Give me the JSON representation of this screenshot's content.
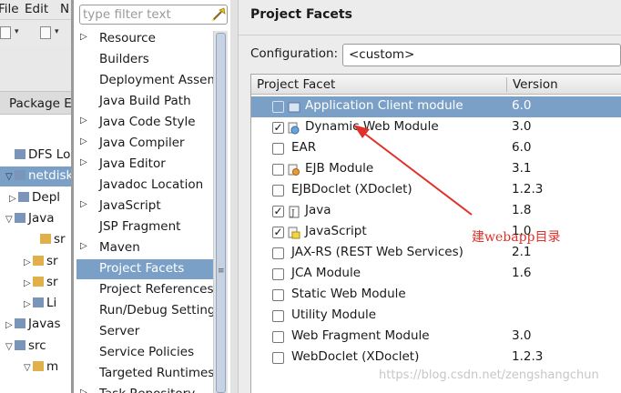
{
  "menubar": {
    "items": [
      "File",
      "Edit",
      "N"
    ]
  },
  "package_tab": {
    "label": "Package E"
  },
  "left_tree": [
    {
      "label": "DFS Loc",
      "twisty": ""
    },
    {
      "label": "netdisk",
      "twisty": "▽"
    },
    {
      "label": "Depl",
      "twisty": "▷"
    },
    {
      "label": "Java",
      "twisty": "▽"
    },
    {
      "label": "sr",
      "twisty": ""
    },
    {
      "label": "sr",
      "twisty": "▷"
    },
    {
      "label": "sr",
      "twisty": "▷"
    },
    {
      "label": "Li",
      "twisty": "▷"
    },
    {
      "label": "Javas",
      "twisty": "▷"
    },
    {
      "label": "src",
      "twisty": "▽"
    },
    {
      "label": "m",
      "twisty": "▽"
    }
  ],
  "filter": {
    "placeholder": "type filter text"
  },
  "nav": {
    "items": [
      {
        "label": "Resource",
        "expandable": true
      },
      {
        "label": "Builders",
        "expandable": false
      },
      {
        "label": "Deployment Assem",
        "expandable": false
      },
      {
        "label": "Java Build Path",
        "expandable": false
      },
      {
        "label": "Java Code Style",
        "expandable": true
      },
      {
        "label": "Java Compiler",
        "expandable": true
      },
      {
        "label": "Java Editor",
        "expandable": true
      },
      {
        "label": "Javadoc Location",
        "expandable": false
      },
      {
        "label": "JavaScript",
        "expandable": true
      },
      {
        "label": "JSP Fragment",
        "expandable": false
      },
      {
        "label": "Maven",
        "expandable": true
      },
      {
        "label": "Project Facets",
        "expandable": false,
        "selected": true
      },
      {
        "label": "Project References",
        "expandable": false
      },
      {
        "label": "Run/Debug Settings",
        "expandable": false
      },
      {
        "label": "Server",
        "expandable": false
      },
      {
        "label": "Service Policies",
        "expandable": false
      },
      {
        "label": "Targeted Runtimes",
        "expandable": false
      },
      {
        "label": "Task Repository",
        "expandable": true
      }
    ]
  },
  "page": {
    "title": "Project Facets"
  },
  "configuration": {
    "label": "Configuration:",
    "value": "<custom>"
  },
  "facets_table": {
    "headers": {
      "facet": "Project Facet",
      "version": "Version"
    },
    "rows": [
      {
        "name": "Application Client module",
        "version": "6.0",
        "checked": false,
        "selected": true,
        "icon": "app-client-icon"
      },
      {
        "name": "Dynamic Web Module",
        "version": "3.0",
        "checked": true,
        "selected": false,
        "icon": "web-module-icon"
      },
      {
        "name": "EAR",
        "version": "6.0",
        "checked": false,
        "selected": false,
        "icon": ""
      },
      {
        "name": "EJB Module",
        "version": "3.1",
        "checked": false,
        "selected": false,
        "icon": "ejb-module-icon"
      },
      {
        "name": "EJBDoclet (XDoclet)",
        "version": "1.2.3",
        "checked": false,
        "selected": false,
        "icon": ""
      },
      {
        "name": "Java",
        "version": "1.8",
        "checked": true,
        "selected": false,
        "icon": "java-file-icon"
      },
      {
        "name": "JavaScript",
        "version": "1.0",
        "checked": true,
        "selected": false,
        "icon": "javascript-icon"
      },
      {
        "name": "JAX-RS (REST Web Services)",
        "version": "2.1",
        "checked": false,
        "selected": false,
        "icon": ""
      },
      {
        "name": "JCA Module",
        "version": "1.6",
        "checked": false,
        "selected": false,
        "icon": ""
      },
      {
        "name": "Static Web Module",
        "version": "",
        "checked": false,
        "selected": false,
        "icon": ""
      },
      {
        "name": "Utility Module",
        "version": "",
        "checked": false,
        "selected": false,
        "icon": ""
      },
      {
        "name": "Web Fragment Module",
        "version": "3.0",
        "checked": false,
        "selected": false,
        "icon": ""
      },
      {
        "name": "WebDoclet (XDoclet)",
        "version": "1.2.3",
        "checked": false,
        "selected": false,
        "icon": ""
      }
    ]
  },
  "annotation": {
    "text": "建webapp目录",
    "color": "#e0302a"
  },
  "watermark": {
    "text": "https://blog.csdn.net/zengshangchun"
  },
  "colors": {
    "selection": "#7aa0c8",
    "annotation": "#e0302a"
  }
}
